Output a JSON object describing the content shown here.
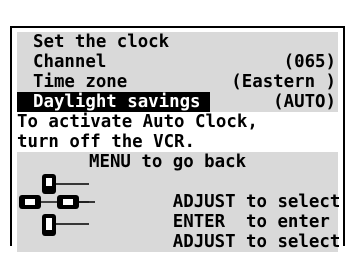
{
  "menu": {
    "title": "Set the clock",
    "items": [
      {
        "label": "Channel",
        "value": "(065)"
      },
      {
        "label": "Time zone",
        "value": "(Eastern )"
      },
      {
        "label": "Daylight savings",
        "value": "(AUTO)"
      }
    ],
    "note_line1": "To activate Auto Clock,",
    "note_line2": "turn off the VCR."
  },
  "help": {
    "menu_back": "MENU to go back",
    "adjust_select_1": "ADJUST to select",
    "enter_enter": "ENTER  to enter",
    "adjust_select_2": "ADJUST to select"
  },
  "icons": [
    "clock-icon",
    "circle-bullet-icon",
    "menu-button-icon",
    "dpad-up-icon",
    "dpad-left-icon",
    "dpad-right-icon",
    "dpad-down-icon"
  ]
}
